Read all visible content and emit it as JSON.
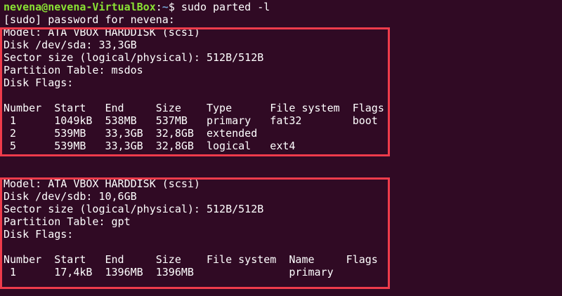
{
  "prompt": {
    "user_host": "nevena@nevena-VirtualBox",
    "sep": ":",
    "path": "~",
    "symbol": "$ ",
    "command": "sudo parted -l"
  },
  "sudo_prompt": "[sudo] password for nevena:",
  "disks": [
    {
      "info": [
        "Model: ATA VBOX HARDDISK (scsi)",
        "Disk /dev/sda: 33,3GB",
        "Sector size (logical/physical): 512B/512B",
        "Partition Table: msdos",
        "Disk Flags:"
      ],
      "header": "Number  Start   End     Size    Type      File system  Flags",
      "rows": [
        " 1      1049kB  538MB   537MB   primary   fat32        boot",
        " 2      539MB   33,3GB  32,8GB  extended",
        " 5      539MB   33,3GB  32,8GB  logical   ext4"
      ]
    },
    {
      "info": [
        "Model: ATA VBOX HARDDISK (scsi)",
        "Disk /dev/sdb: 10,6GB",
        "Sector size (logical/physical): 512B/512B",
        "Partition Table: gpt",
        "Disk Flags:"
      ],
      "header": "Number  Start   End     Size    File system  Name     Flags",
      "rows": [
        " 1      17,4kB  1396MB  1396MB               primary"
      ]
    }
  ],
  "colors": {
    "background": "#300a24",
    "highlight": "#ef3b4b",
    "user": "#8ae234",
    "path": "#729fcf"
  }
}
